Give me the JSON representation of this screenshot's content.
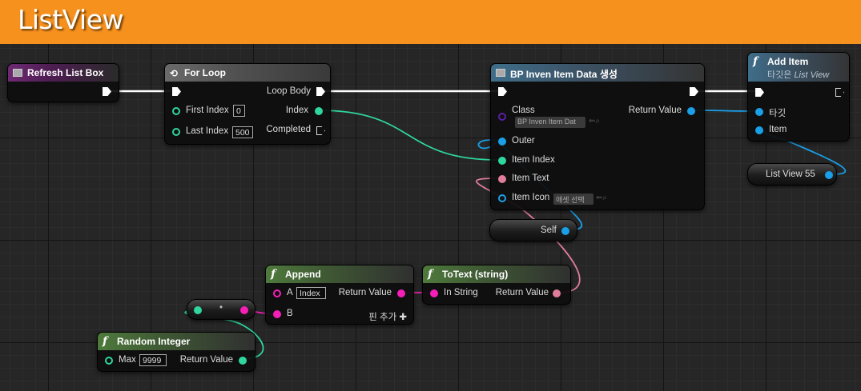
{
  "header": {
    "title": "ListView"
  },
  "colors": {
    "exec": "#ffffff",
    "int": "#2fd6a0",
    "object": "#1aa0e8",
    "string": "#f51fb8",
    "text": "#e07d9c",
    "class": "#5b1fa8"
  },
  "nodes": {
    "refresh": {
      "title": "Refresh List Box"
    },
    "forloop": {
      "title": "For Loop",
      "first_index_label": "First Index",
      "first_index_value": "0",
      "last_index_label": "Last Index",
      "last_index_value": "500",
      "loop_body_label": "Loop Body",
      "index_label": "Index",
      "completed_label": "Completed"
    },
    "bpinven": {
      "title": "BP Inven Item Data 생성",
      "class_label": "Class",
      "class_value": "BP Inven Item Dat",
      "return_label": "Return Value",
      "outer_label": "Outer",
      "item_index_label": "Item Index",
      "item_text_label": "Item Text",
      "item_icon_label": "Item Icon",
      "item_icon_value": "애셋 선택"
    },
    "additem": {
      "title": "Add Item",
      "subtitle_prefix": "타깃은",
      "subtitle_target": "List View",
      "target_label": "타깃",
      "item_label": "Item"
    },
    "listview_var": {
      "label": "List View 55"
    },
    "self_var": {
      "label": "Self"
    },
    "append": {
      "title": "Append",
      "a_label": "A",
      "a_value": "Index",
      "b_label": "B",
      "return_label": "Return Value",
      "add_pin_label": "핀 추가"
    },
    "totext": {
      "title": "ToText (string)",
      "in_label": "In String",
      "return_label": "Return Value"
    },
    "random": {
      "title": "Random Integer",
      "max_label": "Max",
      "max_value": "9999",
      "return_label": "Return Value"
    }
  }
}
